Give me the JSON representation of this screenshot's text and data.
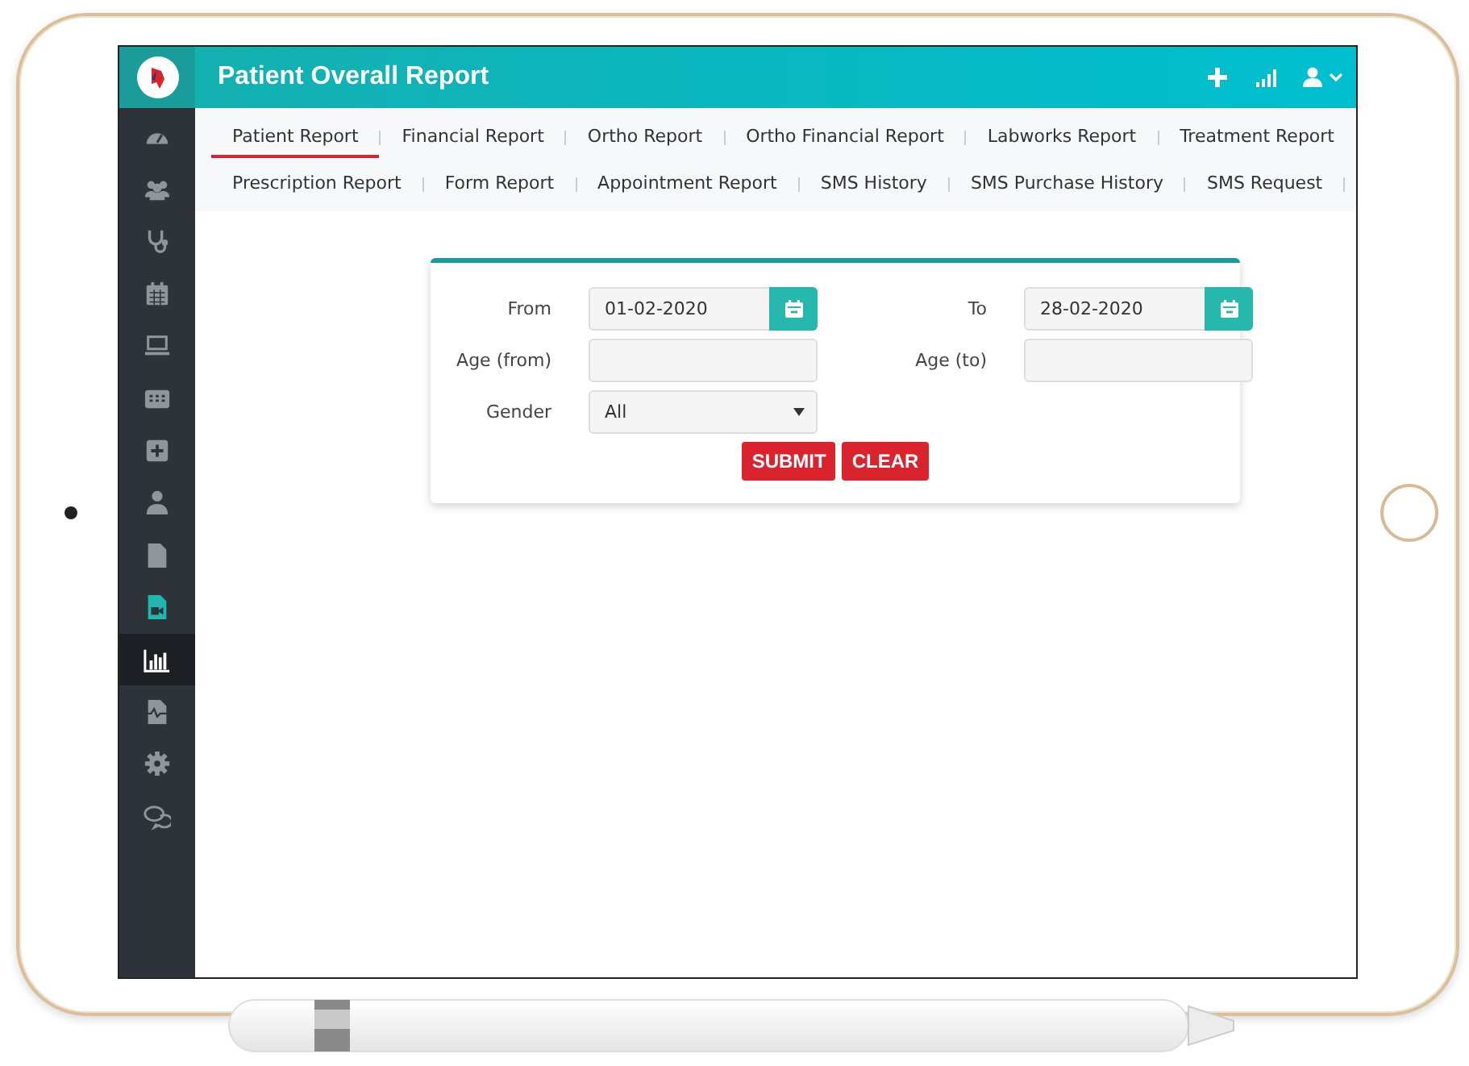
{
  "header": {
    "title": "Patient Overall Report"
  },
  "sidebar": {
    "items": [
      {
        "selected": false,
        "highlighted": false
      },
      {
        "selected": false,
        "highlighted": false
      },
      {
        "selected": false,
        "highlighted": false
      },
      {
        "selected": false,
        "highlighted": false
      },
      {
        "selected": false,
        "highlighted": false
      },
      {
        "selected": false,
        "highlighted": false
      },
      {
        "selected": false,
        "highlighted": false
      },
      {
        "selected": false,
        "highlighted": false
      },
      {
        "selected": false,
        "highlighted": false
      },
      {
        "selected": false,
        "highlighted": true
      },
      {
        "selected": true,
        "highlighted": false
      },
      {
        "selected": false,
        "highlighted": false
      },
      {
        "selected": false,
        "highlighted": false
      },
      {
        "selected": false,
        "highlighted": false
      }
    ]
  },
  "tabs": [
    [
      {
        "label": "Patient Report",
        "selected": true
      },
      {
        "label": "Financial Report",
        "selected": false
      },
      {
        "label": "Ortho Report",
        "selected": false
      },
      {
        "label": "Ortho Financial Report",
        "selected": false
      },
      {
        "label": "Labworks Report",
        "selected": false
      },
      {
        "label": "Treatment Report",
        "selected": false
      }
    ],
    [
      {
        "label": "Prescription Report",
        "selected": false
      },
      {
        "label": "Form Report",
        "selected": false
      },
      {
        "label": "Appointment Report",
        "selected": false
      },
      {
        "label": "SMS History",
        "selected": false
      },
      {
        "label": "SMS Purchase History",
        "selected": false
      },
      {
        "label": "SMS Request",
        "selected": false
      }
    ]
  ],
  "form": {
    "fields": [
      {
        "kind": "date",
        "label": "From",
        "value": "01-02-2020"
      },
      {
        "kind": "date",
        "label": "To",
        "value": "28-02-2020"
      },
      {
        "kind": "text",
        "label": "Age (from)"
      },
      {
        "kind": "text",
        "label": "Age (to)"
      },
      {
        "kind": "select",
        "label": "Gender",
        "value": "All"
      }
    ],
    "buttons": [
      "SUBMIT",
      "CLEAR"
    ]
  }
}
